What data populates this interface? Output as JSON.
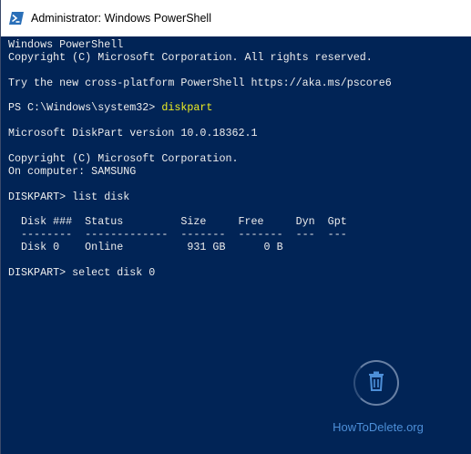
{
  "window": {
    "title": "Administrator: Windows PowerShell"
  },
  "console": {
    "lines": [
      "Windows PowerShell",
      "Copyright (C) Microsoft Corporation. All rights reserved.",
      "",
      "Try the new cross-platform PowerShell https://aka.ms/pscore6",
      "",
      "PS C:\\Windows\\system32> ",
      "",
      "Microsoft DiskPart version 10.0.18362.1",
      "",
      "Copyright (C) Microsoft Corporation.",
      "On computer: SAMSUNG",
      "",
      "DISKPART> list disk",
      "",
      "  Disk ###  Status         Size     Free     Dyn  Gpt",
      "  --------  -------------  -------  -------  ---  ---",
      "  Disk 0    Online          931 GB      0 B",
      "",
      "DISKPART> select disk 0"
    ],
    "prompt_command": "diskpart"
  },
  "watermark": {
    "text": "HowToDelete.org",
    "icon": "trash-icon"
  },
  "colors": {
    "console_background": "#012456",
    "console_text": "#ededed",
    "command_highlight": "#eeee22",
    "watermark": "#4d8fd8"
  }
}
